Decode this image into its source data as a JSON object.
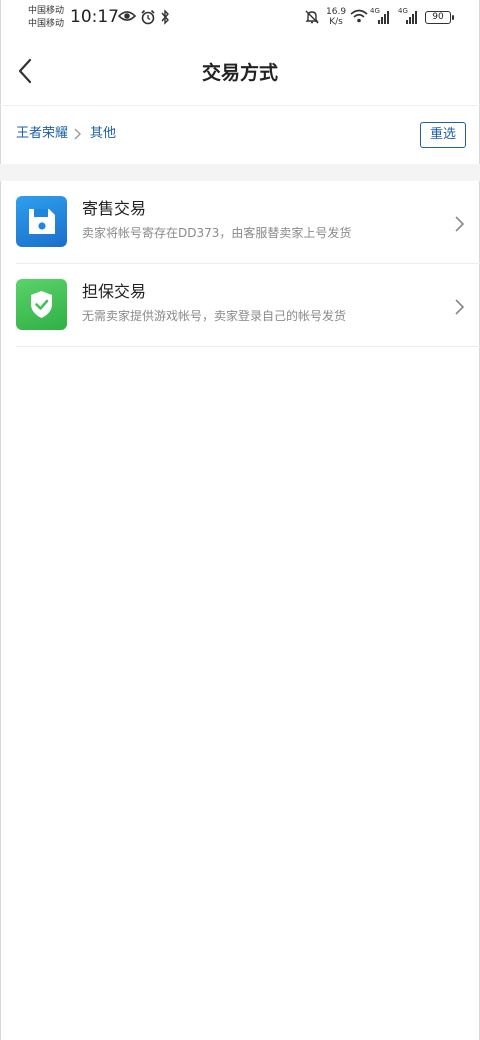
{
  "status_bar": {
    "carrier_1": "中国移动",
    "carrier_2": "中国移动",
    "time": "10:17",
    "net_speed_value": "16.9",
    "net_speed_unit": "K/s",
    "network_1": "4G",
    "network_2": "4G",
    "battery": "90",
    "icons": [
      "eye-icon",
      "alarm-icon",
      "bluetooth-icon",
      "mute-bell-icon",
      "wifi-icon",
      "signal-icon",
      "battery-icon"
    ]
  },
  "header": {
    "title": "交易方式",
    "back_icon": "chevron-left-icon"
  },
  "breadcrumb": {
    "items": [
      "王者荣耀",
      "其他"
    ],
    "reset_label": "重选"
  },
  "trade_methods": [
    {
      "title": "寄售交易",
      "description": "卖家将帐号寄存在DD373，由客服替卖家上号发货",
      "icon": "floppy-disk-icon",
      "icon_color": "#2086dc"
    },
    {
      "title": "担保交易",
      "description": "无需卖家提供游戏帐号，卖家登录自己的帐号发货",
      "icon": "shield-check-icon",
      "icon_color": "#43c257"
    }
  ],
  "colors": {
    "accent": "#1e5fa8",
    "divider": "#ececec"
  }
}
